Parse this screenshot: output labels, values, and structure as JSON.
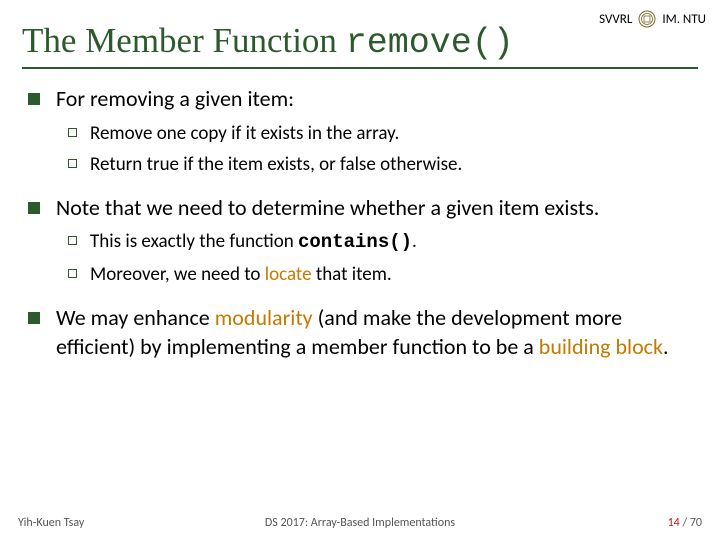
{
  "header": {
    "org_left": "SVVRL",
    "at": "@",
    "org_right": "IM. NTU"
  },
  "title": {
    "prefix": "The Member Function ",
    "code": "remove()"
  },
  "bullets": [
    {
      "text": "For removing a given item:",
      "sub": [
        {
          "text": "Remove one copy if it exists in the array."
        },
        {
          "text": "Return true if the item exists, or false otherwise."
        }
      ]
    },
    {
      "text": "Note that we need to determine whether a given item exists.",
      "sub": [
        {
          "pre": "This is exactly the function ",
          "code": "contains()",
          "post": "."
        },
        {
          "pre": "Moreover, we need to ",
          "hl": "locate",
          "post": " that item."
        }
      ]
    },
    {
      "pre1": "We may enhance ",
      "hl1": "modularity",
      "mid": " (and make the development more efficient) by implementing a member function to be a ",
      "hl2": "building block",
      "post": "."
    }
  ],
  "footer": {
    "left": "Yih-Kuen Tsay",
    "center": "DS 2017: Array-Based Implementations",
    "page_current": "14",
    "page_sep": " / ",
    "page_total": "70"
  }
}
